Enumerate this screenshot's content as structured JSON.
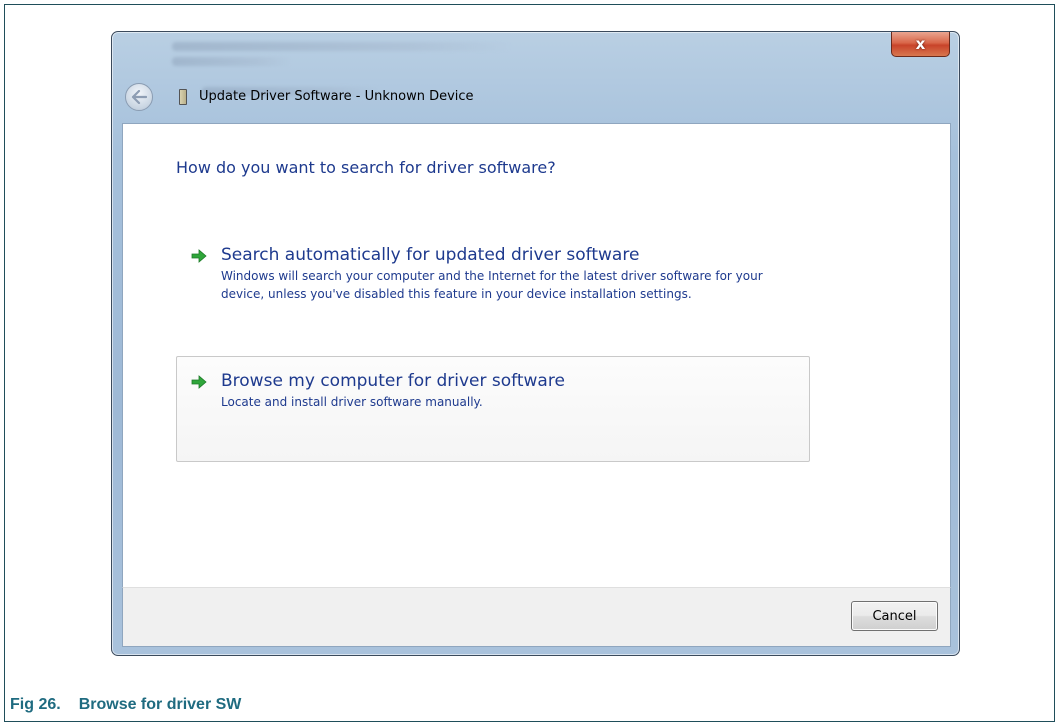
{
  "window": {
    "title": "Update Driver Software - Unknown Device",
    "close_label": "x"
  },
  "main": {
    "heading": "How do you want to search for driver software?",
    "options": [
      {
        "title": "Search automatically for updated driver software",
        "description": "Windows will search your computer and the Internet for the latest driver software for your device, unless you've disabled this feature in your device installation settings.",
        "icon": "green-arrow-icon"
      },
      {
        "title": "Browse my computer for driver software",
        "description": "Locate and install driver software manually.",
        "icon": "green-arrow-icon"
      }
    ]
  },
  "footer": {
    "cancel_label": "Cancel"
  },
  "caption": {
    "number": "Fig 26.",
    "text": "Browse for driver SW"
  },
  "colors": {
    "heading_blue": "#1e3a8e",
    "caption_teal": "#1f6b80",
    "arrow_green": "#2fa63a"
  }
}
